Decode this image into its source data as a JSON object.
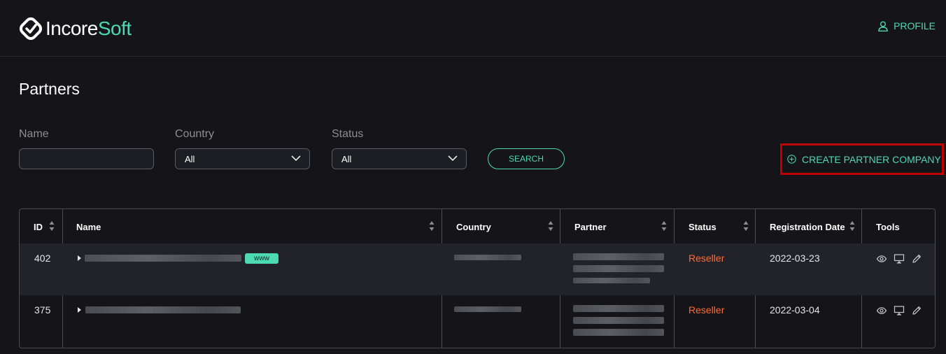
{
  "header": {
    "logo_part1": "Incore",
    "logo_part2": "Soft",
    "profile_label": "PROFILE"
  },
  "page": {
    "title": "Partners"
  },
  "filters": {
    "name_label": "Name",
    "name_value": "",
    "country_label": "Country",
    "country_value": "All",
    "status_label": "Status",
    "status_value": "All",
    "search_label": "SEARCH"
  },
  "create_button": {
    "label": "CREATE PARTNER COMPANY"
  },
  "table": {
    "columns": [
      "ID",
      "Name",
      "Country",
      "Partner",
      "Status",
      "Registration Date",
      "Tools"
    ],
    "rows": [
      {
        "id": "402",
        "badge": "www",
        "status": "Reseller",
        "registration_date": "2022-03-23"
      },
      {
        "id": "375",
        "badge": "",
        "status": "Reseller",
        "registration_date": "2022-03-04"
      }
    ]
  },
  "colors": {
    "accent": "#4dd9b1",
    "status_reseller": "#ff6b35",
    "highlight_border": "#c00000"
  },
  "icons": {
    "logo": "incoresoft-logo-mark",
    "profile": "user-icon",
    "create": "plus-circle-icon",
    "select": "chevron-down-icon",
    "sort": "sort-icon",
    "expand": "caret-right-icon",
    "tools": [
      "eye-icon",
      "monitor-icon",
      "pencil-icon"
    ]
  }
}
